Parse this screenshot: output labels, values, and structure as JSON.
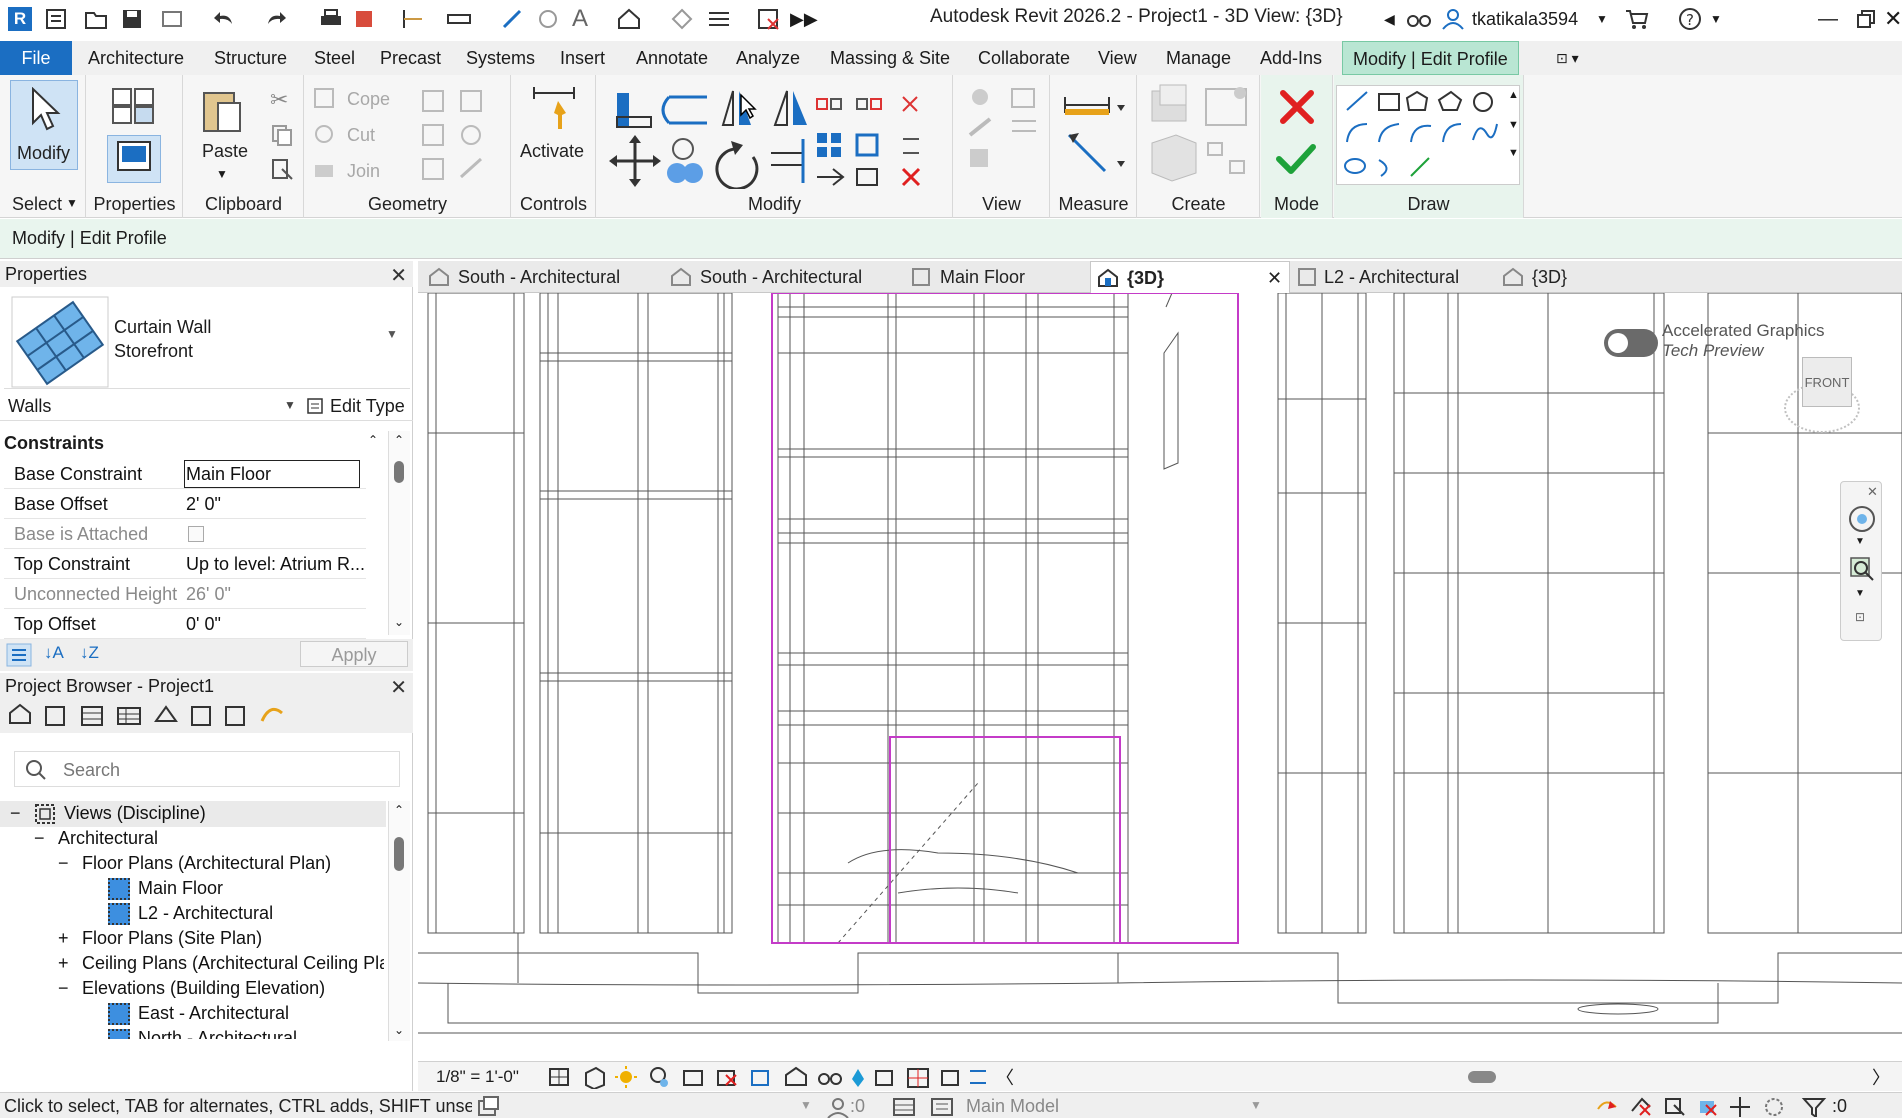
{
  "window": {
    "title": "Autodesk Revit 2026.2 - Project1 - 3D View: {3D}",
    "user": "tkatikala3594"
  },
  "menu_tabs": [
    {
      "label": "File"
    },
    {
      "label": "Architecture"
    },
    {
      "label": "Structure"
    },
    {
      "label": "Steel"
    },
    {
      "label": "Precast"
    },
    {
      "label": "Systems"
    },
    {
      "label": "Insert"
    },
    {
      "label": "Annotate"
    },
    {
      "label": "Analyze"
    },
    {
      "label": "Massing & Site"
    },
    {
      "label": "Collaborate"
    },
    {
      "label": "View"
    },
    {
      "label": "Manage"
    },
    {
      "label": "Add-Ins"
    },
    {
      "label": "Modify | Edit Profile"
    }
  ],
  "ribbon": {
    "select": {
      "button": "Modify",
      "label": "Select"
    },
    "properties": {
      "label": "Properties"
    },
    "clipboard": {
      "button": "Paste",
      "label": "Clipboard"
    },
    "geometry": {
      "cope": "Cope",
      "cut": "Cut",
      "join": "Join",
      "label": "Geometry"
    },
    "controls": {
      "button": "Activate",
      "label": "Controls"
    },
    "modify": {
      "label": "Modify"
    },
    "view": {
      "label": "View"
    },
    "measure": {
      "label": "Measure"
    },
    "create": {
      "label": "Create"
    },
    "mode": {
      "label": "Mode"
    },
    "draw": {
      "label": "Draw"
    }
  },
  "options_bar": {
    "context": "Modify | Edit Profile"
  },
  "properties_panel": {
    "title": "Properties",
    "type_line1": "Curtain Wall",
    "type_line2": "Storefront",
    "filter": "Walls",
    "edit_type": "Edit Type",
    "group": "Constraints",
    "rows": [
      {
        "key": "Base Constraint",
        "value": "Main Floor",
        "disabled": false
      },
      {
        "key": "Base Offset",
        "value": "2'  0\"",
        "disabled": false
      },
      {
        "key": "Base is Attached",
        "value": "",
        "disabled": true
      },
      {
        "key": "Top Constraint",
        "value": "Up to level: Atrium R...",
        "disabled": false
      },
      {
        "key": "Unconnected Height",
        "value": "26'  0\"",
        "disabled": true
      },
      {
        "key": "Top Offset",
        "value": "0'  0\"",
        "disabled": false
      }
    ],
    "apply": "Apply"
  },
  "project_browser": {
    "title": "Project Browser - Project1",
    "search_placeholder": "Search",
    "nodes": [
      {
        "label": "Views (Discipline)",
        "expander": "−"
      },
      {
        "label": "Architectural",
        "expander": "−"
      },
      {
        "label": "Floor Plans (Architectural Plan)",
        "expander": "−"
      },
      {
        "label": "Main Floor",
        "expander": ""
      },
      {
        "label": "L2 - Architectural",
        "expander": ""
      },
      {
        "label": "Floor Plans (Site Plan)",
        "expander": "+"
      },
      {
        "label": "Ceiling Plans (Architectural Ceiling Pla",
        "expander": "+"
      },
      {
        "label": "Elevations (Building Elevation)",
        "expander": "−"
      },
      {
        "label": "East - Architectural",
        "expander": ""
      },
      {
        "label": "North - Architectural",
        "expander": ""
      }
    ]
  },
  "view_tabs": [
    {
      "label": "South - Architectural"
    },
    {
      "label": "South - Architectural"
    },
    {
      "label": "Main Floor"
    },
    {
      "label": "{3D}"
    },
    {
      "label": "L2 - Architectural"
    },
    {
      "label": "{3D}"
    }
  ],
  "viewport": {
    "toggle_line1": "Accelerated Graphics",
    "toggle_line2": "Tech Preview",
    "viewcube": "FRONT"
  },
  "view_control": {
    "scale": "1/8\" = 1'-0\""
  },
  "status_bar": {
    "hint": "Click to select, TAB for alternates, CTRL adds, SHIFT unselect",
    "zero1": ":0",
    "model": "Main Model",
    "zero2": ":0"
  },
  "colors": {
    "accent": "#1b6ec2",
    "context_tab": "#b9e6d3",
    "selection": "#c43bc8",
    "cancel": "#e02020",
    "finish": "#1ea23a"
  }
}
